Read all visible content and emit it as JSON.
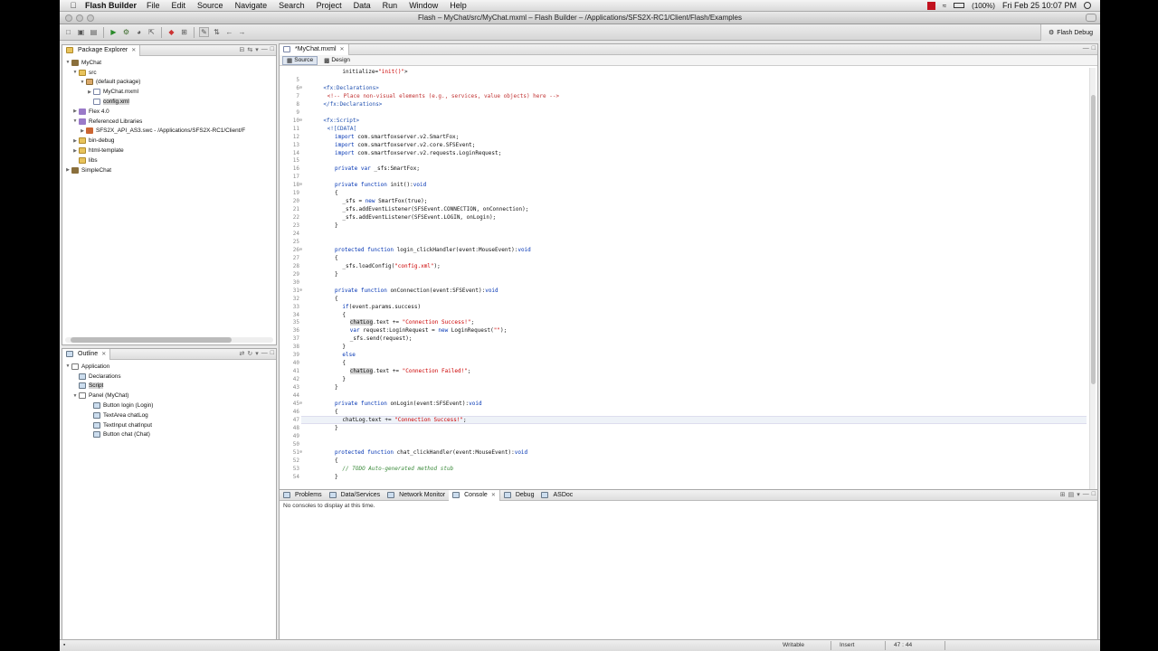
{
  "menubar": {
    "app_name": "Flash Builder",
    "menus": [
      "File",
      "Edit",
      "Source",
      "Navigate",
      "Search",
      "Project",
      "Data",
      "Run",
      "Window",
      "Help"
    ],
    "battery": "(100%)",
    "datetime": "Fri Feb 25  10:07 PM"
  },
  "window": {
    "title": "Flash – MyChat/src/MyChat.mxml – Flash Builder – /Applications/SFS2X-RC1/Client/Flash/Examples",
    "perspective": "Flash Debug"
  },
  "package_explorer": {
    "tab": "Package Explorer",
    "nodes": [
      {
        "label": "MyChat"
      },
      {
        "label": "src"
      },
      {
        "label": "(default package)"
      },
      {
        "label": "MyChat.mxml"
      },
      {
        "label": "config.xml"
      },
      {
        "label": "Flex 4.0"
      },
      {
        "label": "Referenced Libraries"
      },
      {
        "label": "SFS2X_API_AS3.swc - /Applications/SFS2X-RC1/Client/F"
      },
      {
        "label": "bin-debug"
      },
      {
        "label": "html-template"
      },
      {
        "label": "libs"
      },
      {
        "label": "SimpleChat"
      }
    ]
  },
  "outline": {
    "tab": "Outline",
    "nodes": [
      {
        "label": "Application"
      },
      {
        "label": "Declarations"
      },
      {
        "label": "Script"
      },
      {
        "label": "Panel (MyChat)"
      },
      {
        "label": "Button login (Login)"
      },
      {
        "label": "TextArea chatLog"
      },
      {
        "label": "TextInput chatInput"
      },
      {
        "label": "Button chat (Chat)"
      }
    ]
  },
  "editor": {
    "tab": "*MyChat.mxml",
    "modes": [
      "Source",
      "Design"
    ],
    "line_numbers": [
      "",
      "5",
      "6",
      "7",
      "8",
      "9",
      "10",
      "11",
      "12",
      "13",
      "14",
      "15",
      "16",
      "17",
      "18",
      "19",
      "20",
      "21",
      "22",
      "23",
      "24",
      "25",
      "26",
      "27",
      "28",
      "29",
      "30",
      "31",
      "32",
      "33",
      "34",
      "35",
      "36",
      "37",
      "38",
      "39",
      "40",
      "41",
      "42",
      "43",
      "44",
      "45",
      "46",
      "47",
      "48",
      "49",
      "50",
      "51",
      "52",
      "53",
      "54"
    ],
    "lines": [
      "initialize=\"init()\">",
      "",
      "<fx:Declarations>",
      "<!-- Place non-visual elements (e.g., services, value objects) here -->",
      "</fx:Declarations>",
      "",
      "<fx:Script>",
      "<![CDATA[",
      "import com.smartfoxserver.v2.SmartFox;",
      "import com.smartfoxserver.v2.core.SFSEvent;",
      "import com.smartfoxserver.v2.requests.LoginRequest;",
      "",
      "private var _sfs:SmartFox;",
      "",
      "private function init():void",
      "{",
      "_sfs = new SmartFox(true);",
      "_sfs.addEventListener(SFSEvent.CONNECTION, onConnection);",
      "_sfs.addEventListener(SFSEvent.LOGIN, onLogin);",
      "}",
      "",
      "",
      "protected function login_clickHandler(event:MouseEvent):void",
      "{",
      "_sfs.loadConfig(\"config.xml\");",
      "}",
      "",
      "private function onConnection(event:SFSEvent):void",
      "{",
      "if(event.params.success)",
      "{",
      "chatLog.text += \"Connection Success!\";",
      "var request:LoginRequest = new LoginRequest(\"\");",
      "_sfs.send(request);",
      "}",
      "else",
      "{",
      "chatLog.text += \"Connection Failed!\";",
      "}",
      "}",
      "",
      "private function onLogin(event:SFSEvent):void",
      "{",
      "chatLog.text += \"Connection Success!\";",
      "}",
      "",
      "",
      "protected function chat_clickHandler(event:MouseEvent):void",
      "{",
      "// TODO Auto-generated method stub",
      "}"
    ]
  },
  "console": {
    "tabs": [
      "Problems",
      "Data/Services",
      "Network Monitor",
      "Console",
      "Debug",
      "ASDoc"
    ],
    "message": "No consoles to display at this time."
  },
  "statusbar": {
    "writable": "Writable",
    "mode": "Insert",
    "position": "47 : 44"
  }
}
